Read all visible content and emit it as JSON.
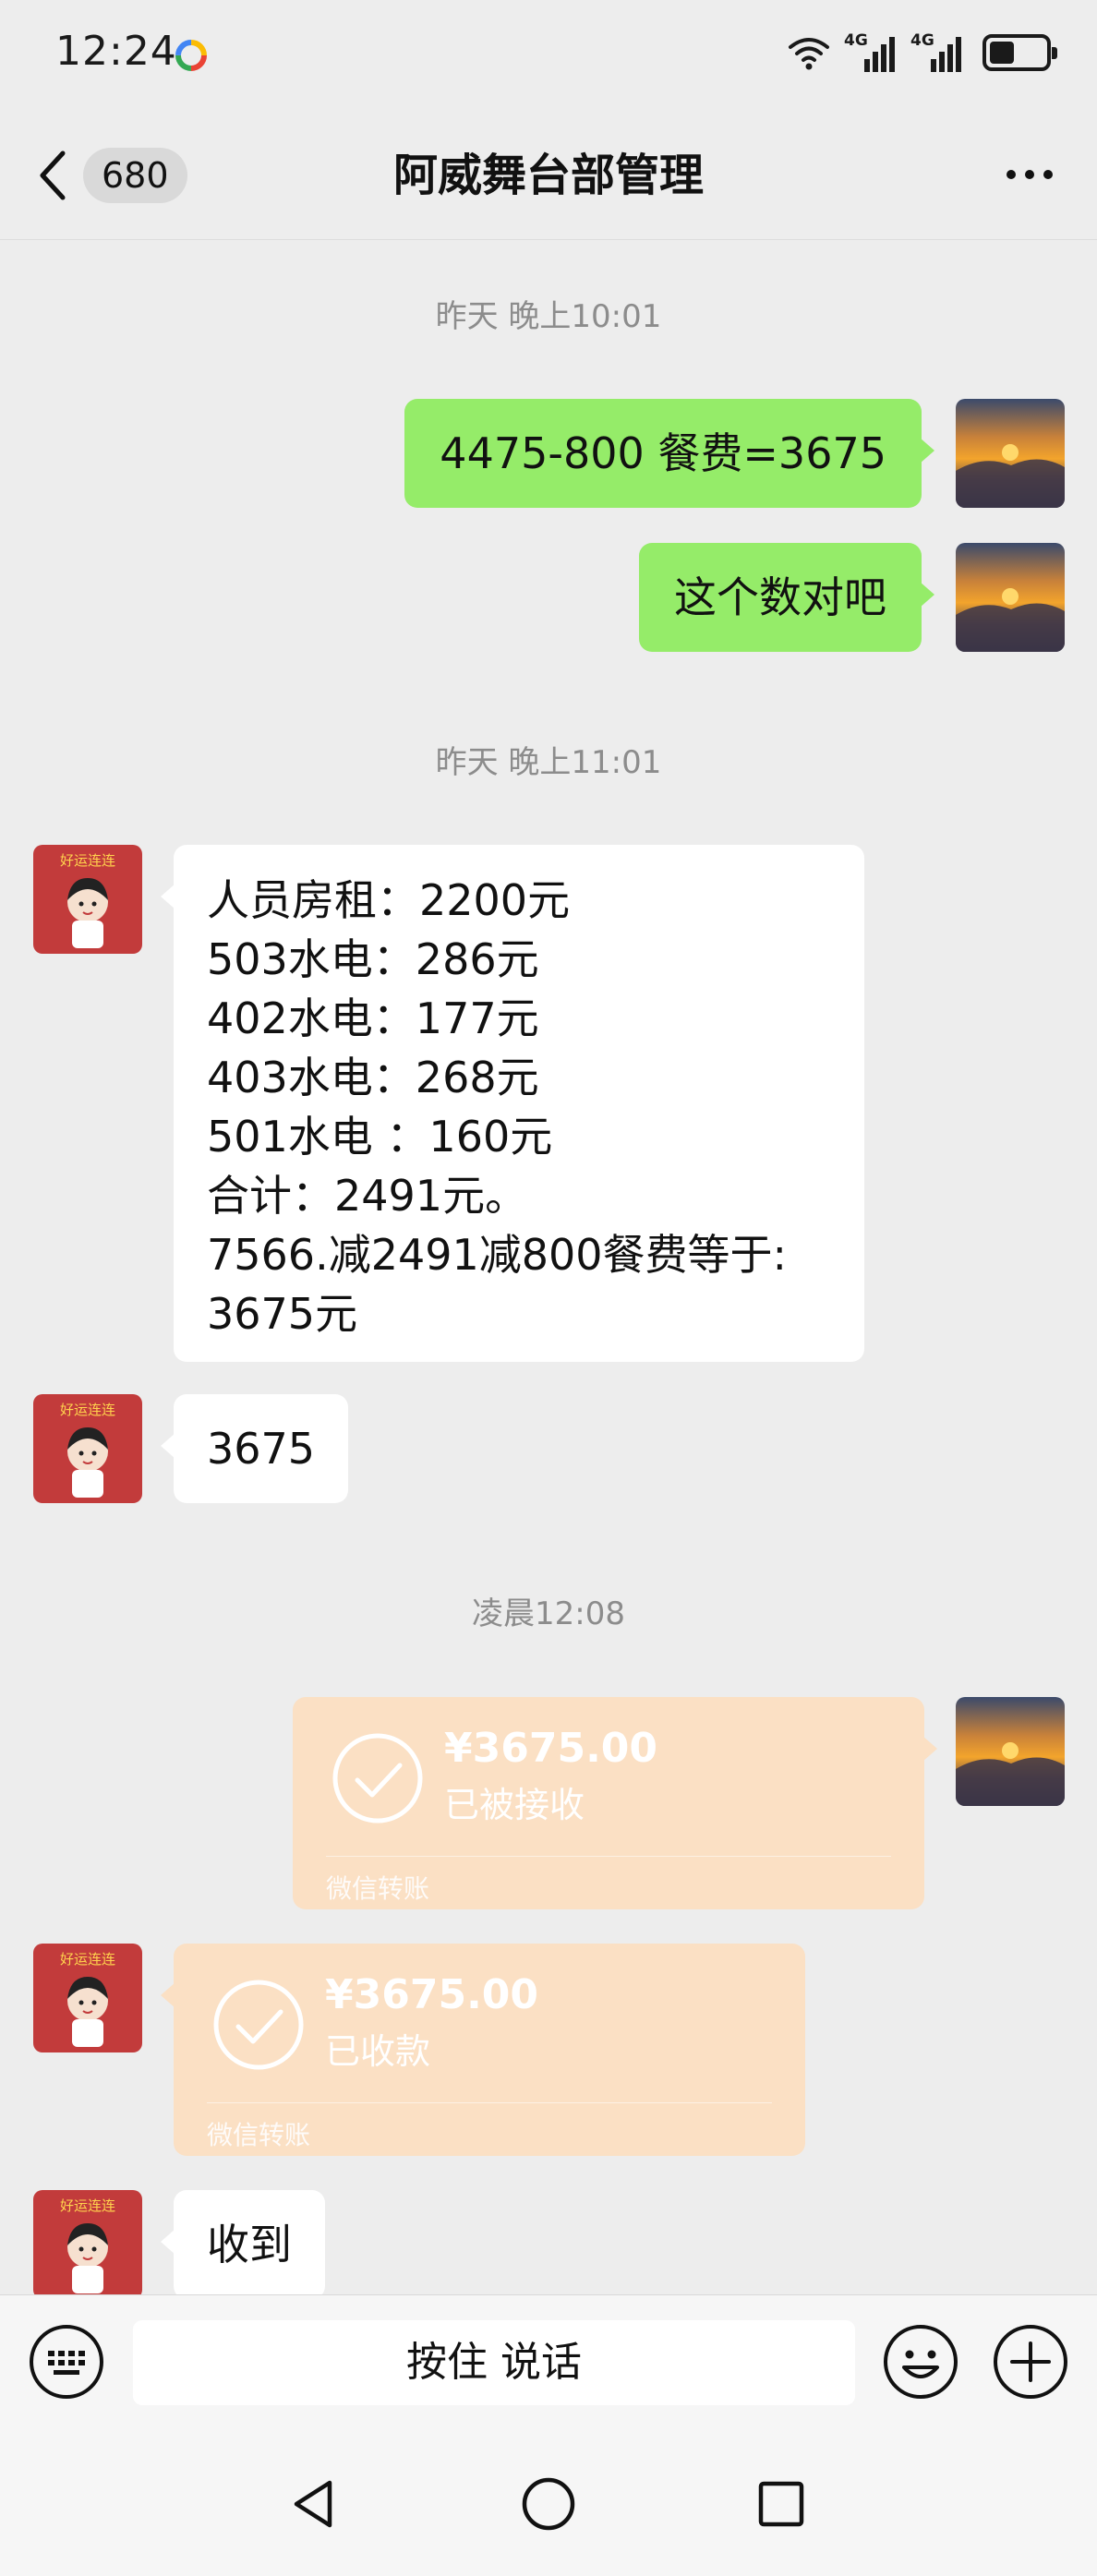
{
  "status_bar": {
    "time": "12:24",
    "network_1": "4G",
    "network_2": "4G",
    "battery_level": 0.45
  },
  "header": {
    "unread_count": "680",
    "title": "阿威舞台部管理"
  },
  "messages": {
    "ts1": "昨天 晚上10:01",
    "out1": "4475-800 餐费=3675",
    "out2": "这个数对吧",
    "ts2": "昨天 晚上11:01",
    "in1_lines": [
      "人员房租：2200元",
      "503水电：286元",
      "402水电：177元",
      "403水电：268元",
      "501水电 ：160元",
      "合计：2491元。",
      "7566.减2491减800餐费等于:",
      "3675元"
    ],
    "in2": "3675",
    "ts3": "凌晨12:08",
    "transfer_out": {
      "amount": "¥3675.00",
      "status": "已被接收",
      "footer": "微信转账"
    },
    "transfer_in": {
      "amount": "¥3675.00",
      "status": "已收款",
      "footer": "微信转账"
    },
    "in3": "收到"
  },
  "input_bar": {
    "hold_to_talk": "按住 说话"
  },
  "colors": {
    "background": "#ededed",
    "outgoing_bubble": "#95ec69",
    "incoming_bubble": "#ffffff",
    "transfer_card": "#fbe0c4"
  },
  "icons": {
    "keyboard": "keyboard-icon",
    "emoji": "emoji-icon",
    "add": "plus-circle-icon",
    "back": "chevron-left-icon",
    "more": "more-dots-icon",
    "nav_back": "triangle-back-icon",
    "nav_home": "circle-home-icon",
    "nav_recent": "square-recent-icon"
  }
}
